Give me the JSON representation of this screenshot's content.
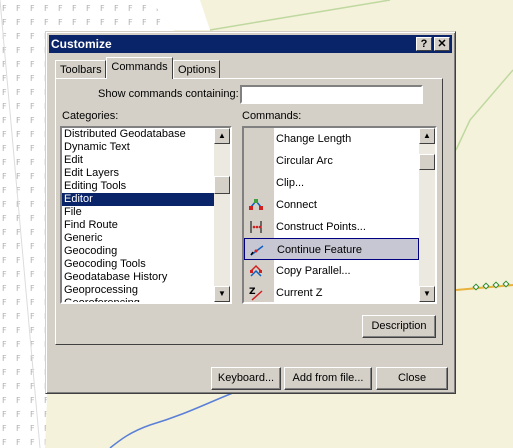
{
  "dialog": {
    "title": "Customize",
    "help_button": "?",
    "close_button": "✕"
  },
  "tabs": [
    {
      "label": "Toolbars"
    },
    {
      "label": "Commands",
      "active": true
    },
    {
      "label": "Options"
    }
  ],
  "search": {
    "label": "Show commands containing:",
    "value": ""
  },
  "categories": {
    "header": "Categories:",
    "items": [
      "Distributed Geodatabase",
      "Dynamic Text",
      "Edit",
      "Edit Layers",
      "Editing Tools",
      "Editor",
      "File",
      "Find Route",
      "Generic",
      "Geocoding",
      "Geocoding Tools",
      "Geodatabase History",
      "Geoprocessing",
      "Georeferencing"
    ],
    "selected": "Editor"
  },
  "commands": {
    "header": "Commands:",
    "items": [
      {
        "label": "Change Length",
        "icon": "blank-icon"
      },
      {
        "label": "Circular Arc",
        "icon": "blank-icon"
      },
      {
        "label": "Clip...",
        "icon": "blank-icon"
      },
      {
        "label": "Connect",
        "icon": "connect-icon"
      },
      {
        "label": "Construct Points...",
        "icon": "construct-points-icon"
      },
      {
        "label": "Continue Feature",
        "icon": "continue-feature-icon",
        "selected": true
      },
      {
        "label": "Copy Parallel...",
        "icon": "copy-parallel-icon"
      },
      {
        "label": "Current Z",
        "icon": "current-z-icon"
      }
    ]
  },
  "buttons": {
    "description": "Description",
    "keyboard": "Keyboard...",
    "add_from_file": "Add from file...",
    "close": "Close"
  },
  "colors": {
    "title_bar": "#0a246a",
    "dialog_face": "#d4d0c8",
    "map_background": "#f4f2da",
    "selection": "#0a246a"
  }
}
